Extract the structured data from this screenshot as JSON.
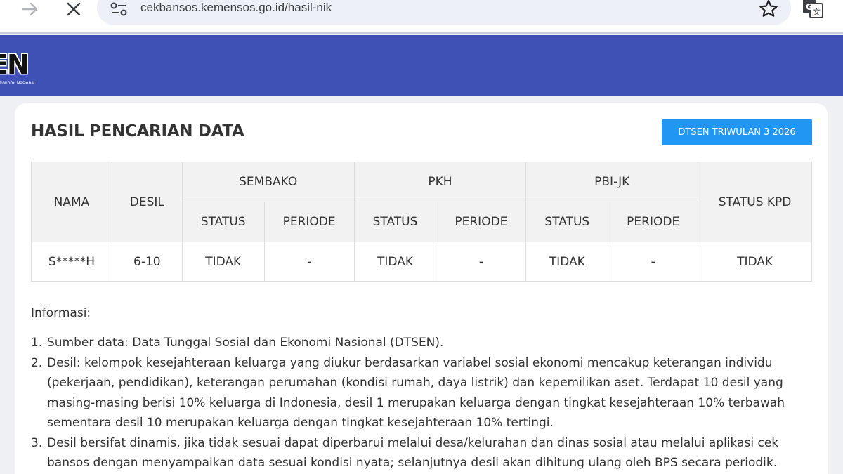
{
  "browser": {
    "url": "cekbansos.kemensos.go.id/hasil-nik"
  },
  "header": {
    "logo_text": "EN",
    "logo_subtext": "konomi Nasional"
  },
  "page": {
    "title": "HASIL PENCARIAN DATA",
    "badge": "DTSEN TRIWULAN 3 2026"
  },
  "table": {
    "headers": {
      "nama": "NAMA",
      "desil": "DESIL",
      "sembako": "SEMBAKO",
      "pkh": "PKH",
      "pbijk": "PBI-JK",
      "status_kpd": "STATUS KPD",
      "status": "STATUS",
      "periode": "PERIODE"
    },
    "rows": [
      {
        "nama": "S*****H",
        "desil": "6-10",
        "sembako_status": "TIDAK",
        "sembako_periode": "-",
        "pkh_status": "TIDAK",
        "pkh_periode": "-",
        "pbijk_status": "TIDAK",
        "pbijk_periode": "-",
        "status_kpd": "TIDAK"
      }
    ]
  },
  "info": {
    "title": "Informasi:",
    "items": [
      {
        "num": "1.",
        "text": "Sumber data: Data Tunggal Sosial dan Ekonomi Nasional (DTSEN)."
      },
      {
        "num": "2.",
        "text": "Desil: kelompok kesejahteraan keluarga yang diukur berdasarkan variabel sosial ekonomi mencakup keterangan individu (pekerjaan, pendidikan), keterangan perumahan (kondisi rumah, daya listrik) dan kepemilikan aset. Terdapat 10 desil yang masing-masing berisi 10% keluarga di Indonesia, desil 1 merupakan keluarga dengan tingkat kesejahteraan 10% terbawah sementara desil 10 merupakan keluarga dengan tingkat kesejahteraan 10% tertingi."
      },
      {
        "num": "3.",
        "text": "Desil bersifat dinamis, jika tidak sesuai dapat diperbarui melalui desa/kelurahan dan dinas sosial atau melalui aplikasi cek bansos dengan menyampaikan data sesuai kondisi nyata; selanjutnya desil akan dihitung ulang oleh BPS secara periodik."
      }
    ]
  },
  "colors": {
    "header_band": "#3f51b5",
    "badge": "#2196f3"
  }
}
